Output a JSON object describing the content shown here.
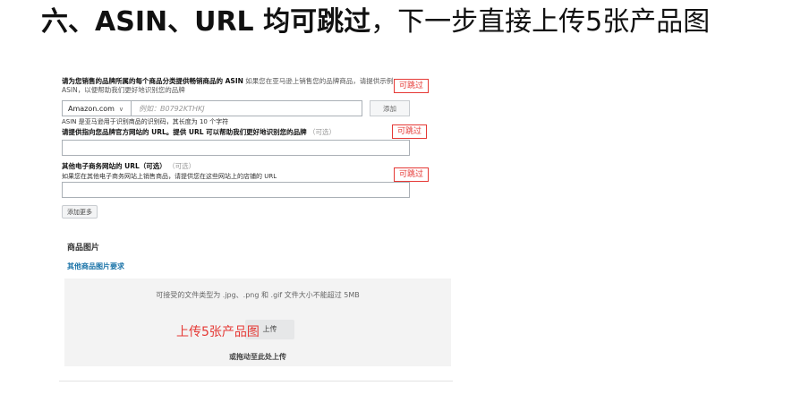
{
  "heading": {
    "bold_text": "六、ASIN、URL 均可跳过",
    "normal_text": "，下一步直接上传5张产品图"
  },
  "asin_section": {
    "title_bold": "请为您销售的品牌所属的每个商品分类提供畅销商品的 ASIN",
    "title_hint": "如果您在亚马逊上销售您的品牌商品，请提供示例 ASIN，以便帮助我们更好地识别您的品牌",
    "skip_tag": "可跳过",
    "marketplace_value": "Amazon.com",
    "asin_placeholder": "例如：B0792KTHKJ",
    "add_button": "添加",
    "helper": "ASIN 是亚马逊用于识别商品的识别码，其长度为 10 个字符"
  },
  "url_section": {
    "title_bold": "请提供指向您品牌官方网站的 URL。提供 URL 可以帮助我们更好地识别您的品牌",
    "optional": "（可选）",
    "skip_tag": "可跳过"
  },
  "other_section": {
    "title_bold": "其他电子商务网站的 URL（可选）",
    "optional": "（可选）",
    "hint": "如果您在其他电子商务网站上销售商品，请提供您在这些网站上的店铺的 URL",
    "skip_tag": "可跳过",
    "add_more_button": "添加更多"
  },
  "images_section": {
    "title": "商品图片",
    "link": "其他商品图片要求",
    "types_text": "可接受的文件类型为 .jpg、.png 和 .gif    文件大小不能超过 5MB",
    "upload_button": "上传",
    "annotation": "上传5张产品图",
    "drag_text": "或拖动至此处上传"
  }
}
